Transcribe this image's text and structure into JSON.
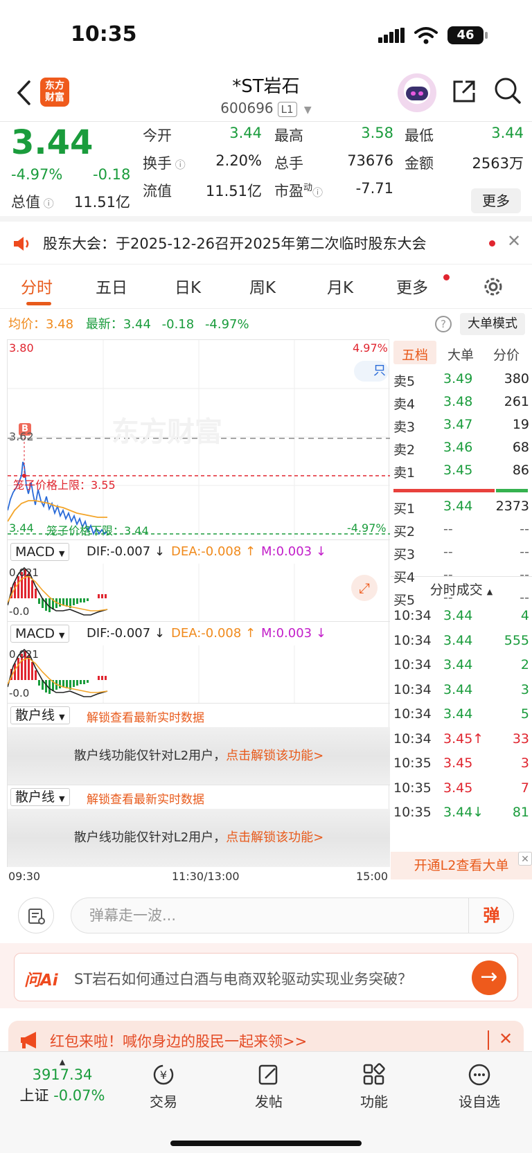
{
  "status_bar": {
    "time": "10:35",
    "battery": "46"
  },
  "header": {
    "title": "*ST岩石",
    "code": "600696",
    "level": "L1",
    "logo": [
      "东方",
      "财富"
    ]
  },
  "quote": {
    "price": "3.44",
    "change_pct": "-4.97%",
    "change": "-0.18",
    "fields": [
      {
        "label": "今开",
        "value": "3.44",
        "color": "green"
      },
      {
        "label": "最高",
        "value": "3.58",
        "color": "green"
      },
      {
        "label": "最低",
        "value": "3.44",
        "color": "green"
      },
      {
        "label": "换手",
        "value": "2.20%",
        "color": "black"
      },
      {
        "label": "总手",
        "value": "73676",
        "color": "black"
      },
      {
        "label": "金额",
        "value": "2563万",
        "color": "black"
      },
      {
        "label": "总值",
        "value": "11.51亿",
        "color": "black"
      },
      {
        "label": "流值",
        "value": "11.51亿",
        "color": "black"
      },
      {
        "label": "市盈",
        "value": "-7.71",
        "color": "black"
      }
    ],
    "pe_superscript": "动",
    "more_label": "更多"
  },
  "notice": {
    "text": "股东大会：于2025-12-26召开2025年第二次临时股东大会"
  },
  "tabs": [
    "分时",
    "五日",
    "日K",
    "周K",
    "月K",
    "更多"
  ],
  "chart": {
    "avg_label": "均价：",
    "avg_value": "3.48",
    "latest_label": "最新：",
    "latest_value": "3.44",
    "latest_change": "-0.18",
    "latest_pct": "-4.97%",
    "big_order_label": "大单模式",
    "watermark": "东方财富",
    "y_top": "3.80",
    "pct_top": "4.97%",
    "y_mid": "3.62",
    "upper_limit_label": "笼子价格上限：3.55",
    "y_low": "3.44",
    "lower_limit_label": "笼子价格下限：3.44",
    "pct_low": "-4.97%",
    "b_marker": "B",
    "partial_label": "只",
    "macd": [
      {
        "name": "MACD",
        "dif": "DIF:-0.007 ↓",
        "dea": "DEA:-0.008 ↑",
        "m": "M:0.003 ↓",
        "top": "0.021",
        "bottom": "-0.0"
      },
      {
        "name": "MACD",
        "dif": "DIF:-0.007 ↓",
        "dea": "DEA:-0.008 ↑",
        "m": "M:0.003 ↓",
        "top": "0.021",
        "bottom": "-0.0"
      }
    ],
    "retail": [
      {
        "name": "散户线",
        "unlock": "解锁查看最新实时数据",
        "desc": "散户线功能仅针对L2用户，",
        "link": "点击解锁该功能>"
      },
      {
        "name": "散户线",
        "unlock": "解锁查看最新实时数据",
        "desc": "散户线功能仅针对L2用户，",
        "link": "点击解锁该功能>"
      }
    ],
    "time_axis": [
      "09:30",
      "11:30/13:00",
      "15:00"
    ]
  },
  "order_book": {
    "tabs": [
      "五档",
      "大单",
      "分价"
    ],
    "asks": [
      {
        "label": "卖5",
        "price": "3.49",
        "vol": "380"
      },
      {
        "label": "卖4",
        "price": "3.48",
        "vol": "261"
      },
      {
        "label": "卖3",
        "price": "3.47",
        "vol": "19"
      },
      {
        "label": "卖2",
        "price": "3.46",
        "vol": "68"
      },
      {
        "label": "卖1",
        "price": "3.45",
        "vol": "86"
      }
    ],
    "bids": [
      {
        "label": "买1",
        "price": "3.44",
        "vol": "2373"
      },
      {
        "label": "买2",
        "price": "--",
        "vol": "--"
      },
      {
        "label": "买3",
        "price": "--",
        "vol": "--"
      },
      {
        "label": "买4",
        "price": "--",
        "vol": "--"
      },
      {
        "label": "买5",
        "price": "--",
        "vol": "--"
      }
    ],
    "ticks_title": "分时成交",
    "ticks": [
      {
        "time": "10:34",
        "price": "3.44",
        "vol": "4",
        "dir": "green"
      },
      {
        "time": "10:34",
        "price": "3.44",
        "vol": "555",
        "dir": "green"
      },
      {
        "time": "10:34",
        "price": "3.44",
        "vol": "2",
        "dir": "green"
      },
      {
        "time": "10:34",
        "price": "3.44",
        "vol": "3",
        "dir": "green"
      },
      {
        "time": "10:34",
        "price": "3.44",
        "vol": "5",
        "dir": "green"
      },
      {
        "time": "10:34",
        "price": "3.45↑",
        "vol": "33",
        "dir": "red"
      },
      {
        "time": "10:35",
        "price": "3.45",
        "vol": "3",
        "dir": "red"
      },
      {
        "time": "10:35",
        "price": "3.45",
        "vol": "7",
        "dir": "red"
      },
      {
        "time": "10:35",
        "price": "3.44↓",
        "vol": "81",
        "dir": "green"
      }
    ],
    "l2_label": "开通L2查看大单"
  },
  "comment": {
    "placeholder": "弹幕走一波...",
    "danmu": "弹"
  },
  "ai": {
    "logo": "问Ai",
    "text": "ST岩石如何通过白酒与电商双轮驱动实现业务突破？"
  },
  "redpacket": {
    "text": "红包来啦！喊你身边的股民一起来领>>"
  },
  "bottom_nav": {
    "index_value": "3917.34",
    "index_label": "上证",
    "index_change": "-0.07%",
    "items": [
      "交易",
      "发帖",
      "功能",
      "设自选"
    ]
  }
}
